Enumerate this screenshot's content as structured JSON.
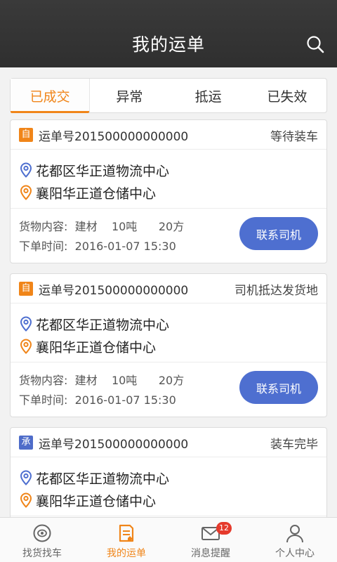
{
  "header": {
    "title": "我的运单"
  },
  "tabs": [
    {
      "label": "已成交",
      "active": true
    },
    {
      "label": "异常",
      "active": false
    },
    {
      "label": "抵运",
      "active": false
    },
    {
      "label": "已失效",
      "active": false
    }
  ],
  "orders": [
    {
      "badge": "自",
      "waybill": "运单号201500000000000",
      "status": "等待装车",
      "from": "花都区华正道物流中心",
      "to": "襄阳华正道仓储中心",
      "cargo_label": "货物内容:",
      "cargo_type": "建材",
      "cargo_weight": "10吨",
      "cargo_volume": "20方",
      "time_label": "下单时间:",
      "time_value": "2016-01-07 15:30",
      "button": "联系司机"
    },
    {
      "badge": "自",
      "waybill": "运单号201500000000000",
      "status": "司机抵达发货地",
      "from": "花都区华正道物流中心",
      "to": "襄阳华正道仓储中心",
      "cargo_label": "货物内容:",
      "cargo_type": "建材",
      "cargo_weight": "10吨",
      "cargo_volume": "20方",
      "time_label": "下单时间:",
      "time_value": "2016-01-07 15:30",
      "button": "联系司机"
    },
    {
      "badge": "承",
      "waybill": "运单号201500000000000",
      "status": "装车完毕",
      "from": "花都区华正道物流中心",
      "to": "襄阳华正道仓储中心"
    }
  ],
  "tabbar": [
    {
      "label": "找货找车",
      "icon": "find-cargo-icon",
      "active": false
    },
    {
      "label": "我的运单",
      "icon": "waybill-icon",
      "active": true
    },
    {
      "label": "消息提醒",
      "icon": "mail-icon",
      "active": false,
      "badge": "12"
    },
    {
      "label": "个人中心",
      "icon": "user-icon",
      "active": false
    }
  ],
  "colors": {
    "accent": "#f08519",
    "button": "#4e6fd0",
    "header": "#333333"
  }
}
